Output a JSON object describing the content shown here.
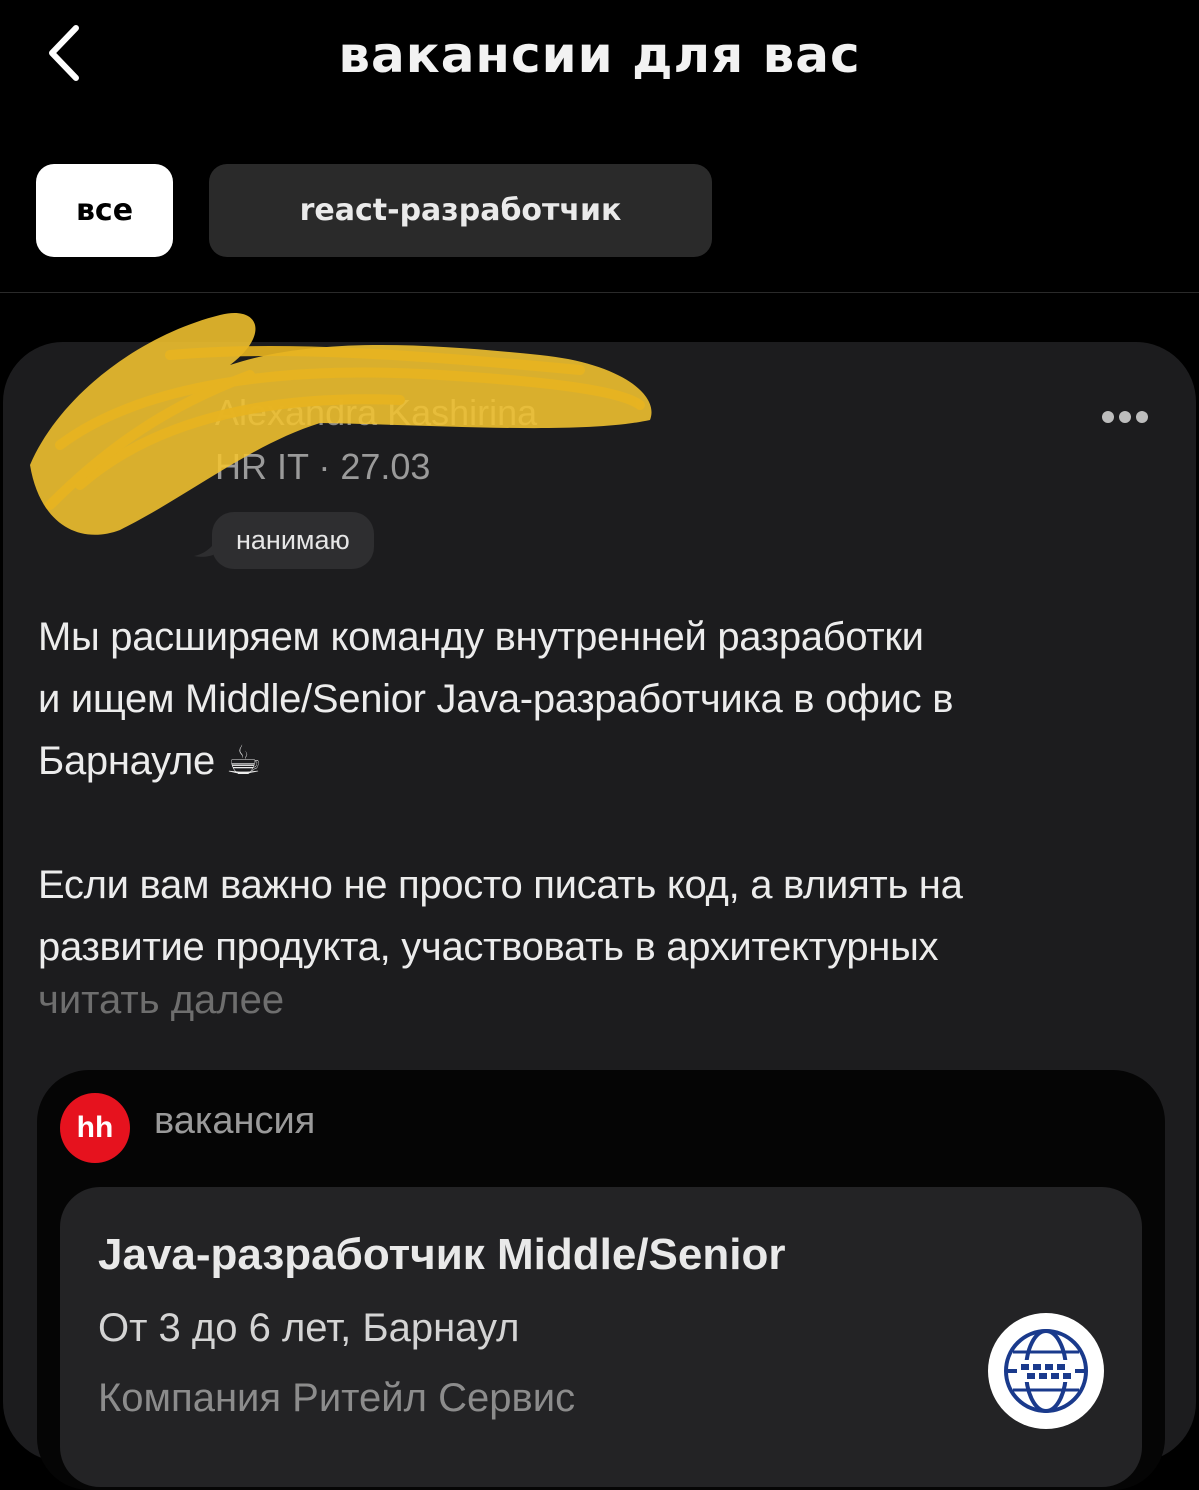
{
  "header": {
    "back_icon": "chevron-left-icon",
    "title": "вакансии для вас"
  },
  "filters": {
    "all_label": "все",
    "react_label": "react-разработчик"
  },
  "post": {
    "author_name": "Alexandra Kashirina",
    "author_meta": "HR IT · 27.03",
    "tag": "нанимаю",
    "more_icon": "more-horizontal-icon",
    "paragraph1_line1": "Мы расширяем команду внутренней разработки",
    "paragraph1_line2": "и ищем Middle/Senior Java-разработчика в офис в",
    "paragraph1_line3": "Барнауле ☕",
    "paragraph2_line1": "Если вам важно не просто писать код, а влиять на",
    "paragraph2_line2": "развитие продукта, участвовать в архитектурных",
    "read_more": "читать далее"
  },
  "vacancy": {
    "source_logo": "hh",
    "source_label": "вакансия",
    "title": "Java-разработчик Middle/Senior",
    "experience_city": "От 3 до 6 лет, Барнаул",
    "company": "Компания Ритейл Сервис"
  },
  "colors": {
    "background": "#000000",
    "card": "#1c1c1e",
    "hh_red": "#e6121e",
    "redaction": "#f4c430"
  }
}
